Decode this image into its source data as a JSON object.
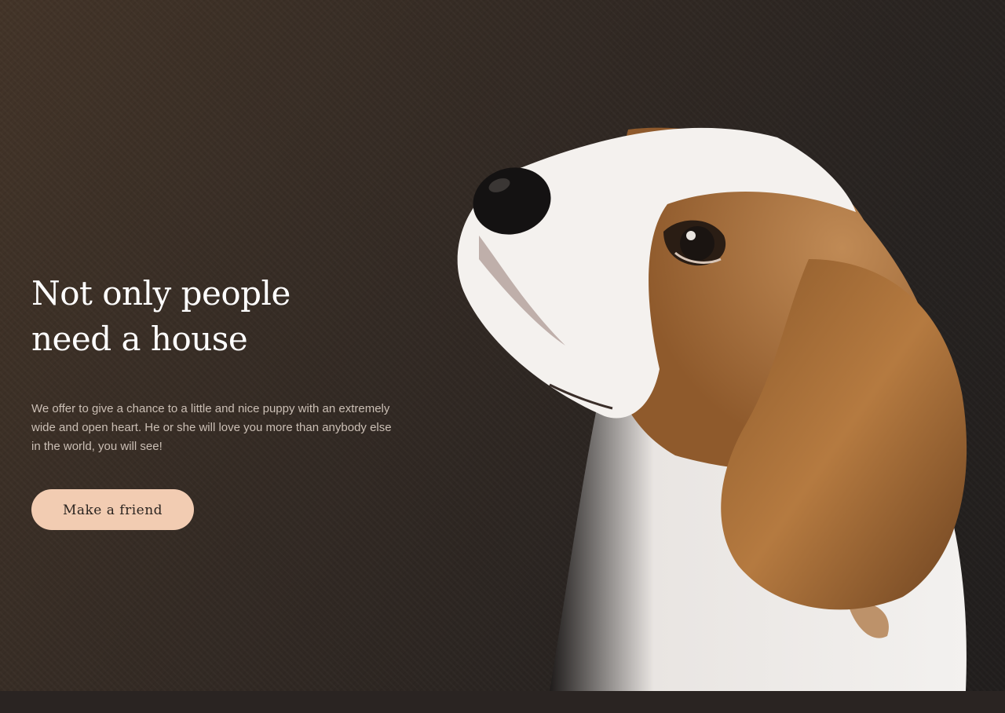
{
  "hero": {
    "title_line1": "Not only people",
    "title_line2": "need a house",
    "description": "We offer to give a chance to a little and nice puppy with an extremely wide and open heart. He or she will love you more than anybody else in the world, you will see!",
    "cta_label": "Make a friend"
  },
  "colors": {
    "background": "#2b2421",
    "title": "#ffffff",
    "description": "#cbbfb5",
    "cta_background": "#f2ccb2",
    "cta_text": "#2b2420"
  },
  "image": {
    "subject": "beagle-puppy-photo"
  }
}
